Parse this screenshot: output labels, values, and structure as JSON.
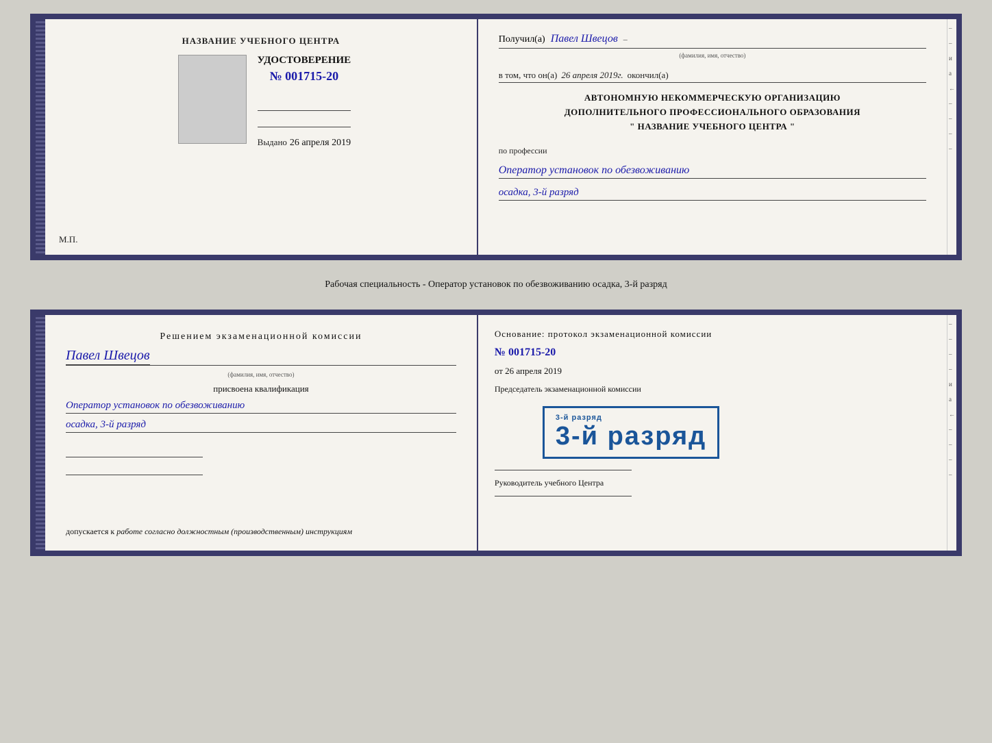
{
  "doc1": {
    "left": {
      "center_label": "НАЗВАНИЕ УЧЕБНОГО ЦЕНТРА",
      "udost_label": "УДОСТОВЕРЕНИЕ",
      "udost_num": "№ 001715-20",
      "vydano_prefix": "Выдано",
      "vydano_date": "26 апреля 2019",
      "mp_label": "М.П."
    },
    "right": {
      "poluchil_prefix": "Получил(а)",
      "name": "Павел Швецов",
      "fio_hint": "(фамилия, имя, отчество)",
      "vtom_prefix": "в том, что он(а)",
      "vtom_date": "26 апреля 2019г.",
      "okончил": "окончил(а)",
      "org_line1": "АВТОНОМНУЮ НЕКОММЕРЧЕСКУЮ ОРГАНИЗАЦИЮ",
      "org_line2": "ДОПОЛНИТЕЛЬНОГО ПРОФЕССИОНАЛЬНОГО ОБРАЗОВАНИЯ",
      "org_line3": "\" НАЗВАНИЕ УЧЕБНОГО ЦЕНТРА \"",
      "profession_label": "по профессии",
      "profession_value": "Оператор установок по обезвоживанию",
      "specialty_value": "осадка, 3-й разряд"
    }
  },
  "separator": {
    "text": "Рабочая специальность - Оператор установок по обезвоживанию осадка, 3-й разряд"
  },
  "doc2": {
    "left": {
      "decision_label": "Решением экзаменационной комиссии",
      "person_name": "Павел Швецов",
      "fio_hint": "(фамилия, имя, отчество)",
      "assigned_label": "присвоена квалификация",
      "qual_line1": "Оператор установок по обезвоживанию",
      "qual_line2": "осадка, 3-й разряд",
      "dopusk_prefix": "допускается к",
      "dopusk_text": "работе согласно должностным (производственным) инструкциям"
    },
    "right": {
      "osnov_label": "Основание: протокол экзаменационной комиссии",
      "protocol_num": "№ 001715-20",
      "ot_prefix": "от",
      "ot_date": "26 апреля 2019",
      "predsed_label": "Председатель экзаменационной комиссии",
      "stamp_text": "3-й разряд",
      "ruk_label": "Руководитель учебного Центра"
    }
  },
  "sidebar": {
    "chars": [
      "–",
      "–",
      "и",
      "а",
      "←",
      "–",
      "–",
      "–",
      "–"
    ]
  }
}
